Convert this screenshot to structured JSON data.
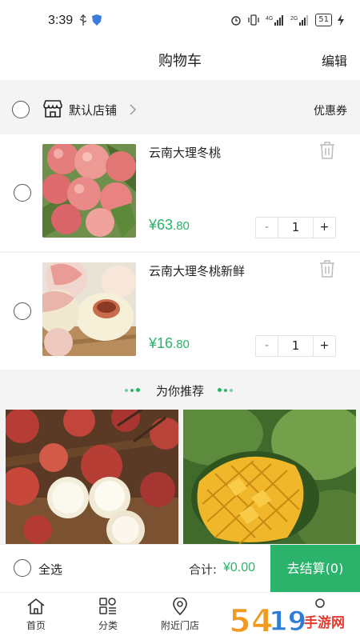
{
  "status_bar": {
    "time": "3:39",
    "battery": "51"
  },
  "header": {
    "title": "购物车",
    "edit": "编辑"
  },
  "store": {
    "name": "默认店铺",
    "coupon": "优惠券"
  },
  "items": [
    {
      "title": "云南大理冬桃",
      "price_symbol": "¥",
      "price_int": "63",
      "price_dec": ".80",
      "qty": "1"
    },
    {
      "title": "云南大理冬桃新鲜",
      "price_symbol": "¥",
      "price_int": "16",
      "price_dec": ".80",
      "qty": "1"
    }
  ],
  "stepper": {
    "minus": "-",
    "plus": "+"
  },
  "recommend": {
    "title": "为你推荐"
  },
  "checkout": {
    "select_all": "全选",
    "total_label": "合计:",
    "total_value": "¥0.00",
    "button": "去结算(0)"
  },
  "tabs": [
    {
      "label": "首页",
      "icon": "home-icon"
    },
    {
      "label": "分类",
      "icon": "category-icon"
    },
    {
      "label": "附近门店",
      "icon": "location-icon"
    }
  ],
  "watermark": {
    "text": "5419手游网"
  },
  "colors": {
    "accent": "#2bb36b",
    "background": "#f4f4f4"
  }
}
